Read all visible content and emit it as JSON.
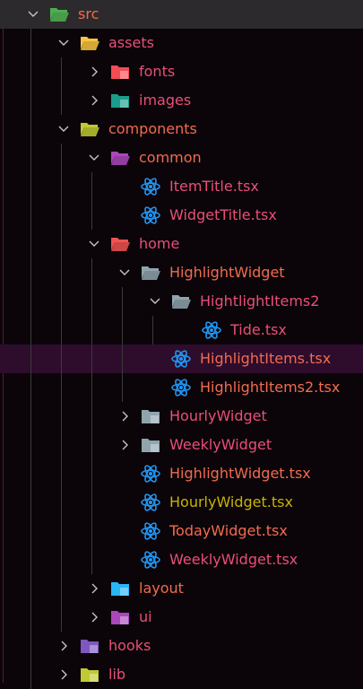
{
  "explorer": {
    "rows": [
      {
        "label": "src",
        "level": 0,
        "kind": "folder",
        "expanded": true,
        "icon": "src-folder-icon",
        "iconColor": "#4caf50",
        "color": "#f26b4f"
      },
      {
        "label": "assets",
        "level": 1,
        "kind": "folder",
        "expanded": true,
        "icon": "assets-folder-icon",
        "iconColor": "#f9c440",
        "color": "#e94f78"
      },
      {
        "label": "fonts",
        "level": 2,
        "kind": "folder",
        "expanded": false,
        "icon": "fonts-folder-icon",
        "iconColor": "#f44c54",
        "color": "#e94f78"
      },
      {
        "label": "images",
        "level": 2,
        "kind": "folder",
        "expanded": false,
        "icon": "images-folder-icon",
        "iconColor": "#1a9d8a",
        "color": "#e94f78"
      },
      {
        "label": "components",
        "level": 1,
        "kind": "folder",
        "expanded": true,
        "icon": "components-folder-icon",
        "iconColor": "#c0ca33",
        "color": "#f26b4f"
      },
      {
        "label": "common",
        "level": 2,
        "kind": "folder",
        "expanded": true,
        "icon": "common-folder-icon",
        "iconColor": "#ab47bc",
        "color": "#f26b4f"
      },
      {
        "label": "ItemTitle.tsx",
        "level": 3,
        "kind": "file",
        "icon": "react-icon",
        "color": "#e94f78"
      },
      {
        "label": "WidgetTitle.tsx",
        "level": 3,
        "kind": "file",
        "icon": "react-icon",
        "color": "#e94f78"
      },
      {
        "label": "home",
        "level": 2,
        "kind": "folder",
        "expanded": true,
        "icon": "home-folder-icon",
        "iconColor": "#ef5350",
        "color": "#e94f78"
      },
      {
        "label": "HighlightWidget",
        "level": 3,
        "kind": "folder",
        "expanded": true,
        "icon": "folder-open-icon",
        "iconColor": "#90a4ae",
        "color": "#f26b4f"
      },
      {
        "label": "HightlightItems2",
        "level": 4,
        "kind": "folder",
        "expanded": true,
        "icon": "folder-open-icon",
        "iconColor": "#90a4ae",
        "color": "#e94f78"
      },
      {
        "label": "Tide.tsx",
        "level": 5,
        "kind": "file",
        "icon": "react-icon",
        "color": "#e94f78"
      },
      {
        "label": "HighlightItems.tsx",
        "level": 4,
        "kind": "file",
        "icon": "react-icon",
        "color": "#f26b4f",
        "selected": true
      },
      {
        "label": "HighlightItems2.tsx",
        "level": 4,
        "kind": "file",
        "icon": "react-icon",
        "color": "#f26b4f"
      },
      {
        "label": "HourlyWidget",
        "level": 3,
        "kind": "folder",
        "expanded": false,
        "icon": "folder-icon",
        "iconColor": "#90a4ae",
        "color": "#e94f78"
      },
      {
        "label": "WeeklyWidget",
        "level": 3,
        "kind": "folder",
        "expanded": false,
        "icon": "folder-icon",
        "iconColor": "#90a4ae",
        "color": "#e94f78"
      },
      {
        "label": "HighlightWidget.tsx",
        "level": 3,
        "kind": "file",
        "icon": "react-icon",
        "color": "#f26b4f"
      },
      {
        "label": "HourlyWidget.tsx",
        "level": 3,
        "kind": "file",
        "icon": "react-icon",
        "color": "#c8b400"
      },
      {
        "label": "TodayWidget.tsx",
        "level": 3,
        "kind": "file",
        "icon": "react-icon",
        "color": "#f26b4f"
      },
      {
        "label": "WeeklyWidget.tsx",
        "level": 3,
        "kind": "file",
        "icon": "react-icon",
        "color": "#e94f78"
      },
      {
        "label": "layout",
        "level": 2,
        "kind": "folder",
        "expanded": false,
        "icon": "layout-folder-icon",
        "iconColor": "#29b6f6",
        "color": "#f26b4f"
      },
      {
        "label": "ui",
        "level": 2,
        "kind": "folder",
        "expanded": false,
        "icon": "ui-folder-icon",
        "iconColor": "#ab47bc",
        "color": "#e94f78"
      },
      {
        "label": "hooks",
        "level": 1,
        "kind": "folder",
        "expanded": false,
        "icon": "hooks-folder-icon",
        "iconColor": "#7e57c2",
        "color": "#e94f78"
      },
      {
        "label": "lib",
        "level": 1,
        "kind": "folder",
        "expanded": false,
        "icon": "lib-folder-icon",
        "iconColor": "#c0ca33",
        "color": "#e94f78"
      }
    ]
  }
}
